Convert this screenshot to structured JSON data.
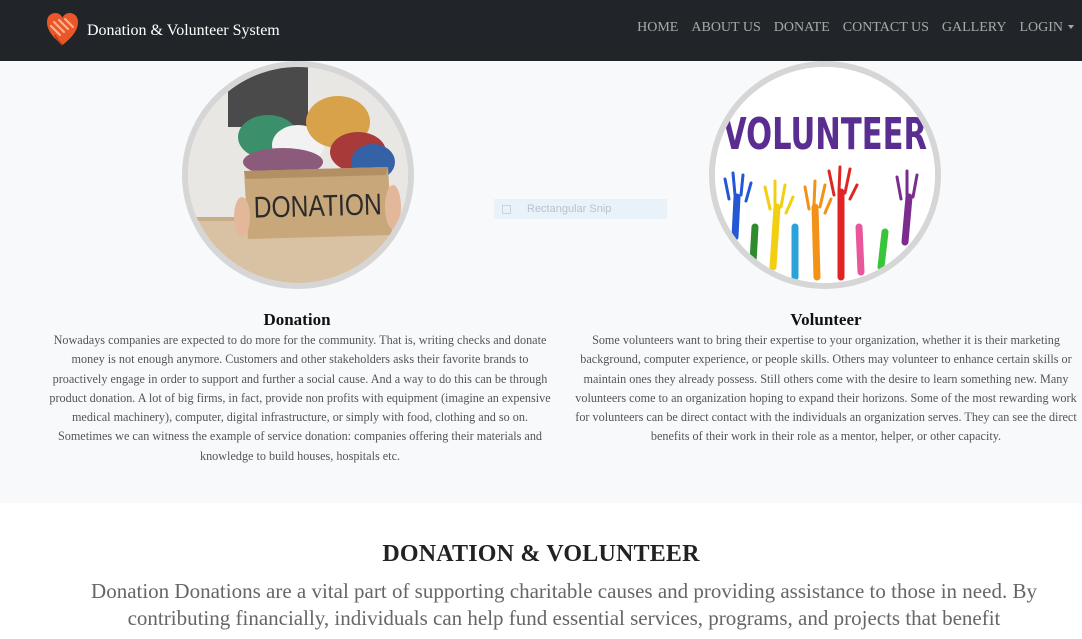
{
  "navbar": {
    "brand": "Donation & Volunteer System",
    "brand_icon": "heart-hands-icon",
    "brand_color": "#e8562a",
    "background": "#212529",
    "items": [
      {
        "label": "HOME"
      },
      {
        "label": "ABOUT US"
      },
      {
        "label": "DONATE"
      },
      {
        "label": "CONTACT US"
      },
      {
        "label": "GALLERY"
      },
      {
        "label": "LOGIN"
      }
    ]
  },
  "overlay": {
    "label": "Rectangular Snip"
  },
  "donation": {
    "box_label": "DONATION",
    "title": "Donation",
    "text": "Nowadays companies are expected to do more for the community. That is, writing checks and donate money is not enough anymore. Customers and other stakeholders asks their favorite brands to proactively engage in order to support and further a social cause. And a way to do this can be through product donation. A lot of big firms, in fact, provide non profits with equipment (imagine an expensive medical machinery), computer, digital infrastructure, or simply with food, clothing and so on. Sometimes we can witness the example of service donation: companies offering their materials and knowledge to build houses, hospitals etc."
  },
  "volunteer": {
    "image_word": "VOLUNTEER",
    "title": "Volunteer",
    "text": "Some volunteers want to bring their expertise to your organization, whether it is their marketing background, computer experience, or people skills. Others may volunteer to enhance certain skills or maintain ones they already possess. Still others come with the desire to learn something new. Many volunteers come to an organization hoping to expand their horizons. Some of the most rewarding work for volunteers can be direct contact with the individuals an organization serves. They can see the direct benefits of their work in their role as a mentor, helper, or other capacity."
  },
  "section2": {
    "heading": "DONATION & VOLUNTEER",
    "paragraph": "Donation Donations are a vital part of supporting charitable causes and providing assistance to those in need. By contributing financially, individuals can help fund essential services, programs, and projects that benefit"
  }
}
